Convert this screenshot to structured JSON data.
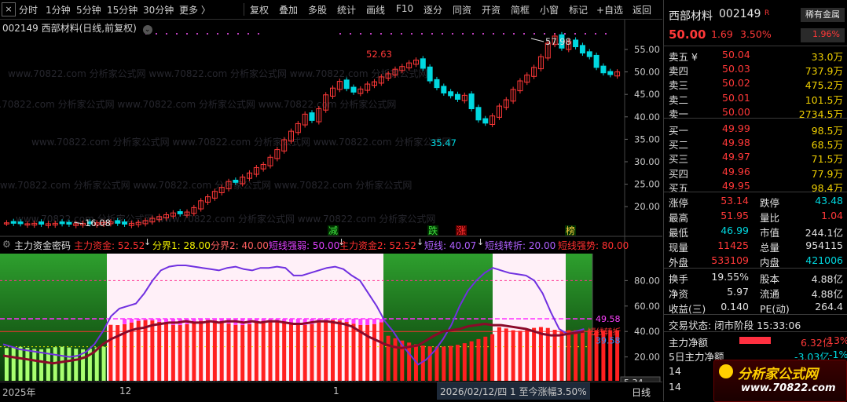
{
  "toolbar": {
    "close": "×",
    "left_items": [
      "分时",
      "1分钟",
      "5分钟",
      "15分钟",
      "30分钟",
      "更多 〉"
    ],
    "right_items": [
      "复权",
      "叠加",
      "多股",
      "统计",
      "画线",
      "F10",
      "逐分",
      "同资",
      "开资",
      "简框",
      "小窗",
      "标记",
      "+自选",
      "返回"
    ]
  },
  "chart": {
    "title": "002149 西部材料(日线,前复权)",
    "watermark": "www.70822.com 分析家公式网",
    "price_labels": [
      "55.00",
      "50.00",
      "45.00",
      "40.00",
      "35.00",
      "30.00",
      "25.00",
      "20.00"
    ],
    "annotations": {
      "high": "52.63",
      "low": "35.47",
      "peak": "57.98",
      "start": "16.08"
    },
    "colors": {
      "up": "#ff3838",
      "down": "#00d8e0",
      "bg": "#000000"
    }
  },
  "indicator": {
    "name": "主力资金密码",
    "header_items": [
      {
        "text": "主力资金: 52.52",
        "color": "#ff3030"
      },
      {
        "text": "分界1: 28.00",
        "color": "#f0f000"
      },
      {
        "text": "分界2: 40.00",
        "color": "#ff6060"
      },
      {
        "text": "短线强弱: 50.00",
        "color": "#e040ff"
      },
      {
        "text": "主力资金2: 52.52",
        "color": "#ff3030"
      },
      {
        "text": "短线: 40.07",
        "color": "#b060ff"
      },
      {
        "text": "短线转折: 20.00",
        "color": "#b060ff"
      },
      {
        "text": "短线强势: 80.00",
        "color": "#ff3030"
      }
    ],
    "markers": [
      {
        "text": "减",
        "color": "#40e040"
      },
      {
        "text": "跌",
        "color": "#40e040"
      },
      {
        "text": "涨",
        "color": "#ff3030"
      },
      {
        "text": "榜",
        "color": "#ffd040"
      }
    ],
    "levels": [
      "80.00",
      "60.00",
      "40.00",
      "20.00"
    ],
    "value_labels": {
      "a": "49.58",
      "b": "39.58",
      "c": "5.34"
    },
    "short_tag": "短线转折",
    "bottom_tag": "短线"
  },
  "bottom_bar": {
    "year": "2025年",
    "month_12": "12",
    "month_1": "1",
    "status": "2026/02/12/四 1 至今涨幅3.50%",
    "period": "日线"
  },
  "quote": {
    "name": "西部材料",
    "code": "002149",
    "badge": "R",
    "industry": "稀有金属",
    "price": "50.00",
    "change": "1.69",
    "change_pct": "3.50%",
    "ratio": "1.96%",
    "asks": [
      {
        "label": "卖五 ¥",
        "price": "50.04",
        "vol": "33.0万"
      },
      {
        "label": "卖四",
        "price": "50.03",
        "vol": "737.9万"
      },
      {
        "label": "卖三",
        "price": "50.02",
        "vol": "475.2万"
      },
      {
        "label": "卖二",
        "price": "50.01",
        "vol": "101.5万"
      },
      {
        "label": "卖一",
        "price": "50.00",
        "vol": "2734.5万"
      }
    ],
    "bids": [
      {
        "label": "买一",
        "price": "49.99",
        "vol": "98.5万"
      },
      {
        "label": "买二",
        "price": "49.98",
        "vol": "68.5万"
      },
      {
        "label": "买三",
        "price": "49.97",
        "vol": "71.5万"
      },
      {
        "label": "买四",
        "price": "49.96",
        "vol": "77.9万"
      },
      {
        "label": "买五",
        "price": "49.95",
        "vol": "98.4万"
      }
    ],
    "stats": [
      {
        "l1": "涨停",
        "v1": "53.14",
        "c1": "up",
        "l2": "跌停",
        "v2": "43.48",
        "c2": "dn"
      },
      {
        "l1": "最高",
        "v1": "51.95",
        "c1": "up",
        "l2": "量比",
        "v2": "1.04",
        "c2": "up"
      },
      {
        "l1": "最低",
        "v1": "46.99",
        "c1": "dn",
        "l2": "市值",
        "v2": "244.1亿",
        "c2": "wt"
      },
      {
        "l1": "现量",
        "v1": "11425",
        "c1": "up",
        "l2": "总量",
        "v2": "954115",
        "c2": "wt"
      },
      {
        "l1": "外盘",
        "v1": "533109",
        "c1": "up",
        "l2": "内盘",
        "v2": "421006",
        "c2": "dn"
      }
    ],
    "stats2": [
      {
        "l1": "换手",
        "v1": "19.55%",
        "l2": "股本",
        "v2": "4.88亿"
      },
      {
        "l1": "净资",
        "v1": "5.97",
        "l2": "流通",
        "v2": "4.88亿"
      },
      {
        "l1": "收益(三)",
        "v1": "0.140",
        "l2": "PE(动)",
        "v2": "264.4"
      }
    ],
    "trade_status": "交易状态: 闭市阶段 15:33:06",
    "net_inflow": {
      "label": "主力净额",
      "value": "6.32亿",
      "pct": "13%"
    },
    "net_inflow5": {
      "label": "5日主力净额",
      "value": "-3.03亿",
      "pct": "-1%"
    },
    "extra_rows": [
      "14",
      "14"
    ]
  },
  "logo": {
    "title": "分析家公式网",
    "url": "www.70822.com"
  }
}
